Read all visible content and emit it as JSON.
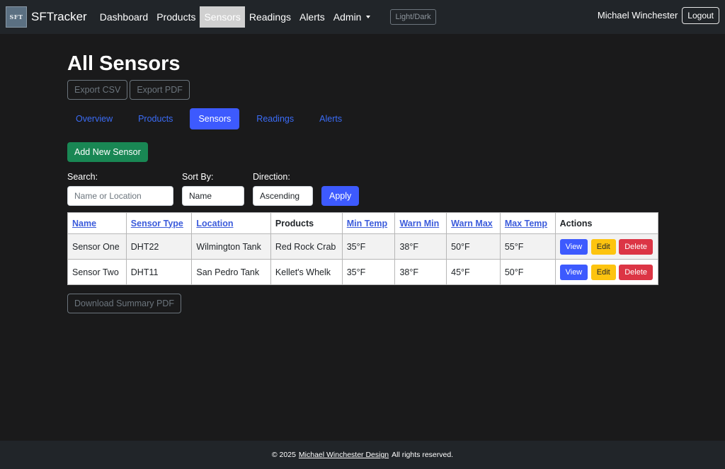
{
  "navbar": {
    "logo_text": "SFT",
    "brand": "SFTracker",
    "links": [
      "Dashboard",
      "Products",
      "Sensors",
      "Readings",
      "Alerts",
      "Admin"
    ],
    "active_link": "Sensors",
    "theme_toggle": "Light/Dark",
    "user_name": "Michael Winchester",
    "logout": "Logout"
  },
  "page": {
    "title": "All Sensors",
    "export_csv": "Export CSV",
    "export_pdf": "Export PDF",
    "tabs": [
      "Overview",
      "Products",
      "Sensors",
      "Readings",
      "Alerts"
    ],
    "active_tab": "Sensors",
    "add_button": "Add New Sensor"
  },
  "filters": {
    "search_label": "Search:",
    "search_placeholder": "Name or Location",
    "sort_label": "Sort By:",
    "sort_value": "Name",
    "direction_label": "Direction:",
    "direction_value": "Ascending",
    "apply": "Apply"
  },
  "table": {
    "headers": [
      "Name",
      "Sensor Type",
      "Location",
      "Products",
      "Min Temp",
      "Warn Min",
      "Warn Max",
      "Max Temp",
      "Actions"
    ],
    "rows": [
      [
        "Sensor One",
        "DHT22",
        "Wilmington Tank",
        "Red Rock Crab",
        "35°F",
        "38°F",
        "50°F",
        "55°F"
      ],
      [
        "Sensor Two",
        "DHT11",
        "San Pedro Tank",
        "Kellet's Whelk",
        "35°F",
        "38°F",
        "45°F",
        "50°F"
      ]
    ],
    "actions": [
      "View",
      "Edit",
      "Delete"
    ]
  },
  "download_summary": "Download Summary PDF",
  "footer": {
    "prefix": "© 2025",
    "link": "Michael Winchester Design",
    "suffix": "All rights reserved."
  },
  "colors": {
    "background": "#1a1a1b",
    "navbar": "#212529",
    "primary": "#3d5afe",
    "success": "#198754",
    "warning": "#fdc40f",
    "danger": "#dc3545"
  }
}
